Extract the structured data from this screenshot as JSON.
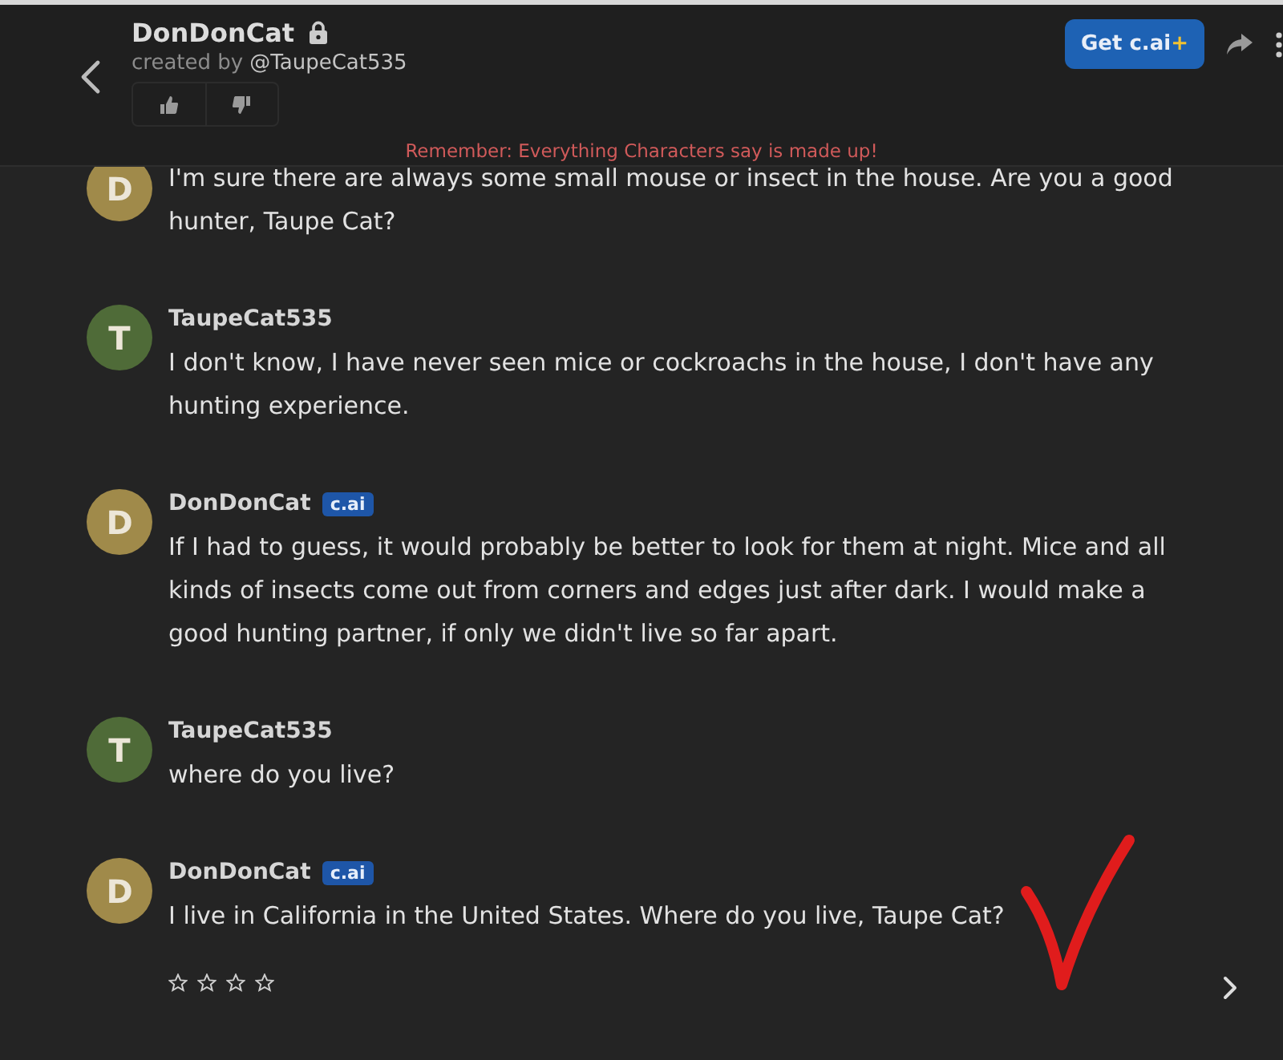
{
  "header": {
    "title": "DonDonCat",
    "locked": true,
    "created_by": "created by",
    "creator": "@TaupeCat535",
    "upgrade_button": {
      "label": "Get c.ai",
      "plus": "+"
    },
    "notice": "Remember: Everything Characters say is made up!"
  },
  "messages": [
    {
      "avatar": "D",
      "color": "#a08a4a",
      "text": "I'm sure there are always some small mouse or insect in the house. Are you a good hunter, Taupe Cat?"
    },
    {
      "avatar": "T",
      "color": "#4f6b38",
      "name": "TaupeCat535",
      "text": "I don't know, I have never seen mice or cockroachs in the house, I don't have any hunting experience."
    },
    {
      "avatar": "D",
      "color": "#a08a4a",
      "name": "DonDonCat",
      "badge": "c.ai",
      "text": "If I had to guess, it would probably be better to look for them at night. Mice and all kinds of insects come out from corners and edges just after dark. I would make a good hunting partner, if only we didn't live so far apart."
    },
    {
      "avatar": "T",
      "color": "#4f6b38",
      "name": "TaupeCat535",
      "text": "where do you live?"
    },
    {
      "avatar": "D",
      "color": "#a08a4a",
      "name": "DonDonCat",
      "badge": "c.ai",
      "text": "I live in California in the United States. Where do you live, Taupe Cat?",
      "stars": 0
    }
  ],
  "annotation": {
    "kind": "check"
  }
}
